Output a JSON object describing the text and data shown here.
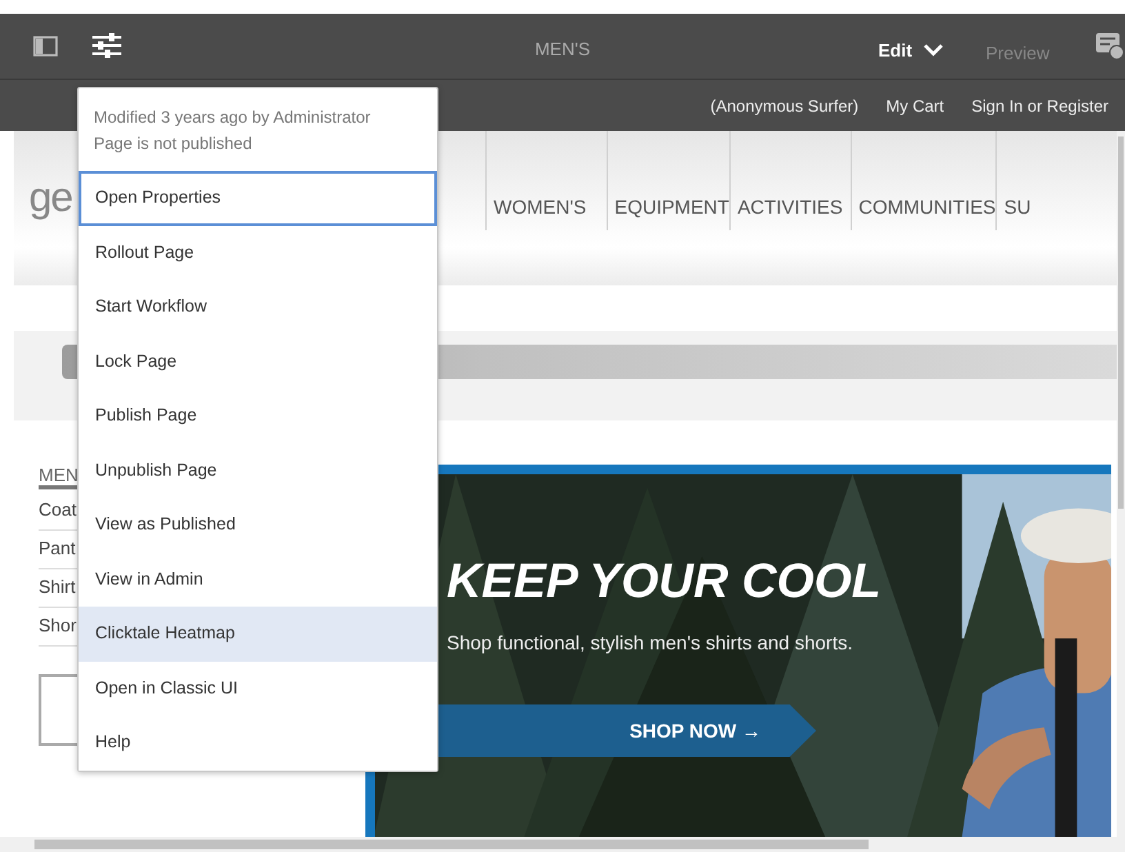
{
  "toolbar": {
    "title": "MEN'S",
    "modes": [
      {
        "label": "Edit",
        "selected": true
      },
      {
        "label": "Preview",
        "selected": false
      }
    ]
  },
  "site_header": {
    "links": [
      "(Anonymous Surfer)",
      "My Cart",
      "Sign In or Register"
    ]
  },
  "site": {
    "logo": "ge",
    "nav": [
      "WOMEN'S",
      "EQUIPMENT",
      "ACTIVITIES",
      "COMMUNITIES",
      "SU"
    ],
    "sidebar": {
      "heading": "MEN",
      "items": [
        "Coat",
        "Pant",
        "Shirt",
        "Shor"
      ]
    },
    "hero": {
      "kind": "picture",
      "headline": "KEEP YOUR COOL",
      "subtitle": "Shop functional, stylish men's shirts and shorts.",
      "button": "SHOP NOW →"
    }
  },
  "page_menu": {
    "info": [
      "Modified 3 years ago by Administrator",
      "Page is not published"
    ],
    "items": [
      {
        "label": "Open Properties",
        "focused": true,
        "highlighted": false
      },
      {
        "label": "Rollout Page",
        "focused": false,
        "highlighted": false
      },
      {
        "label": "Start Workflow",
        "focused": false,
        "highlighted": false
      },
      {
        "label": "Lock Page",
        "focused": false,
        "highlighted": false
      },
      {
        "label": "Publish Page",
        "focused": false,
        "highlighted": false
      },
      {
        "label": "Unpublish Page",
        "focused": false,
        "highlighted": false
      },
      {
        "label": "View as Published",
        "focused": false,
        "highlighted": false
      },
      {
        "label": "View in Admin",
        "focused": false,
        "highlighted": false
      },
      {
        "label": "Clicktale Heatmap",
        "focused": false,
        "highlighted": true
      },
      {
        "label": "Open in Classic UI",
        "focused": false,
        "highlighted": false
      },
      {
        "label": "Help",
        "focused": false,
        "highlighted": false
      }
    ]
  }
}
